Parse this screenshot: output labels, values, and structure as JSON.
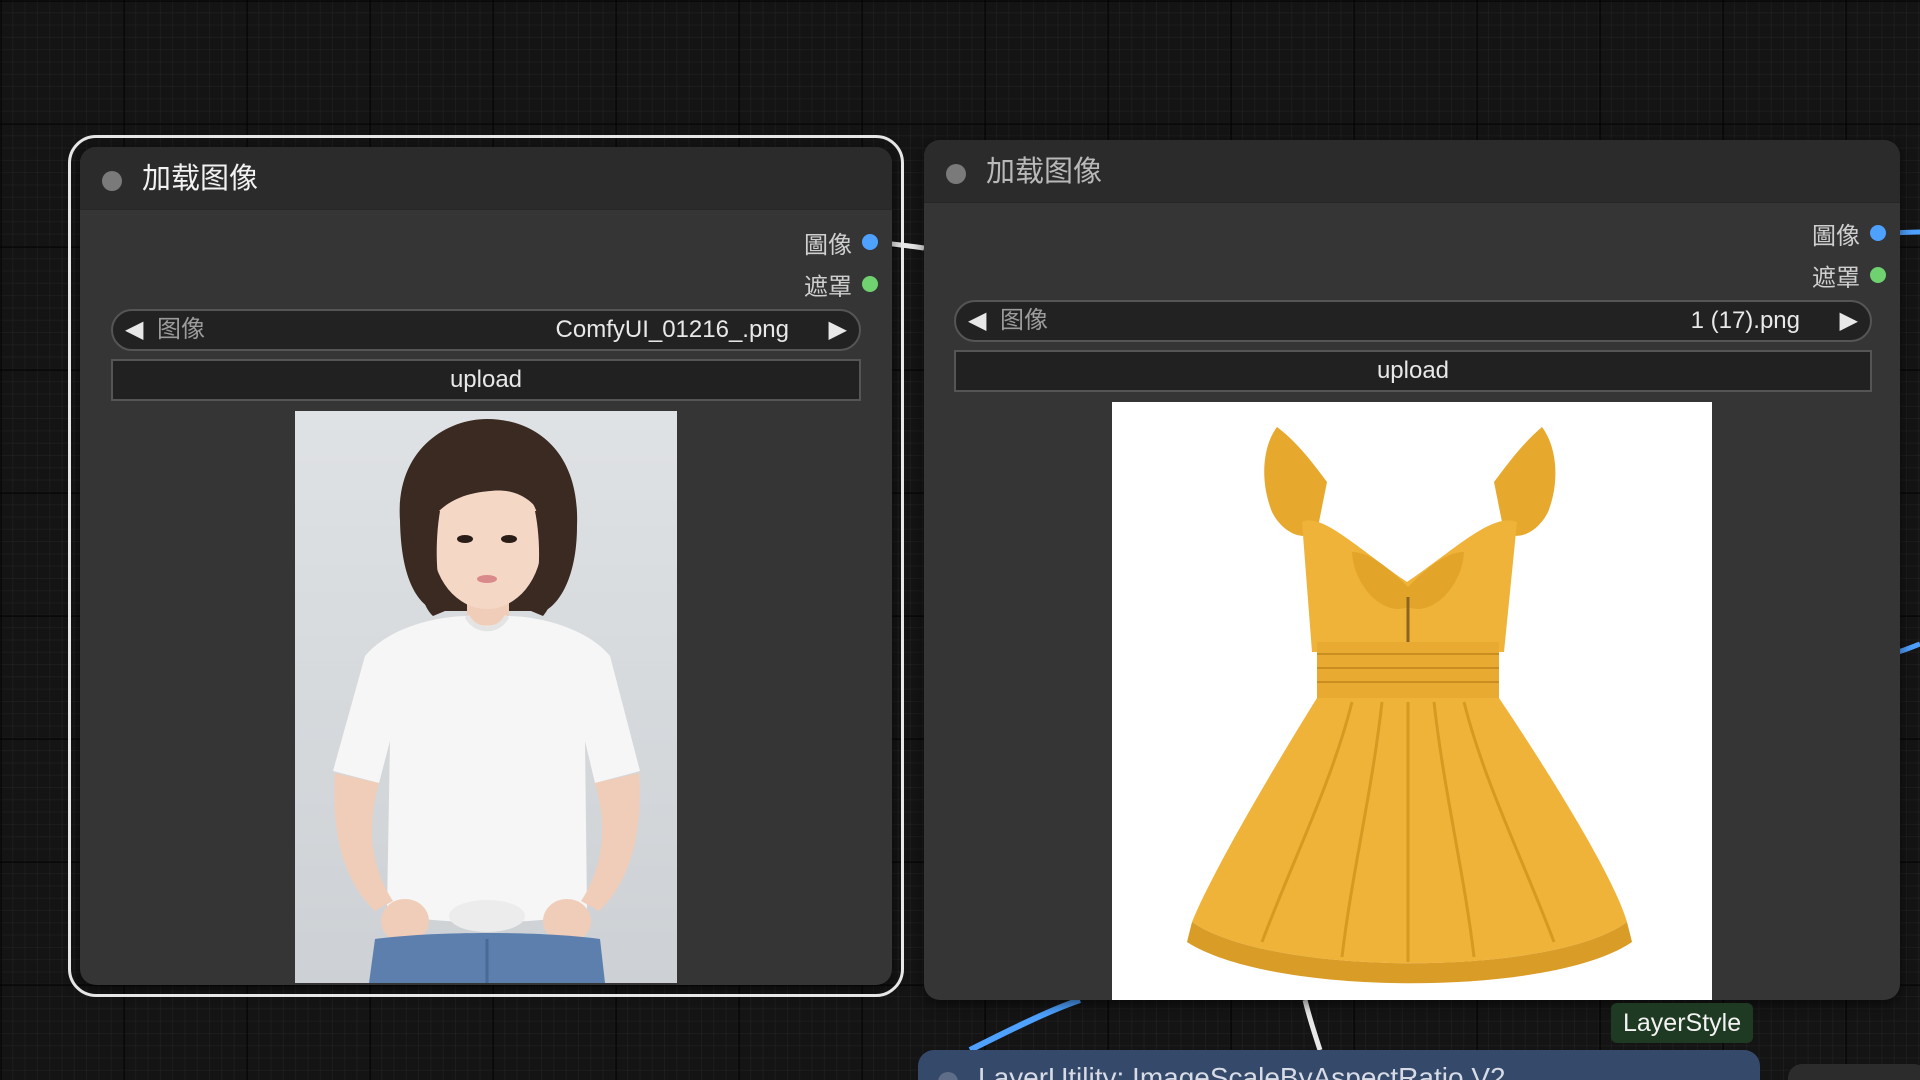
{
  "app": "ComfyUI",
  "colors": {
    "canvas": "#141414",
    "node_body": "#353535",
    "node_header": "#2b2b2b",
    "image_slot": "#4ea1ff",
    "mask_slot": "#6fd16f",
    "link": "#4ea1ff",
    "badge_bg": "#1e3a22",
    "partial_node_bg": "#35496a"
  },
  "nodes": [
    {
      "title": "加载图像",
      "selected": true,
      "outputs": [
        {
          "label": "圖像",
          "slot_color": "#4ea1ff"
        },
        {
          "label": "遮罩",
          "slot_color": "#6fd16f"
        }
      ],
      "widget": {
        "label": "图像",
        "value": "ComfyUI_01216_.png",
        "prev_icon": "◀",
        "next_icon": "▶"
      },
      "upload_label": "upload",
      "preview": "woman in white t-shirt and jeans"
    },
    {
      "title": "加载图像",
      "selected": false,
      "outputs": [
        {
          "label": "圖像",
          "slot_color": "#4ea1ff"
        },
        {
          "label": "遮罩",
          "slot_color": "#6fd16f"
        }
      ],
      "widget": {
        "label": "图像",
        "value": "1 (17).png",
        "prev_icon": "◀",
        "next_icon": "▶"
      },
      "upload_label": "upload",
      "preview": "yellow ruffled sleeveless dress"
    }
  ],
  "badge": {
    "label": "LayerStyle"
  },
  "partial_node": {
    "title": "LayerUtility: ImageScaleByAspectRatio V2"
  }
}
